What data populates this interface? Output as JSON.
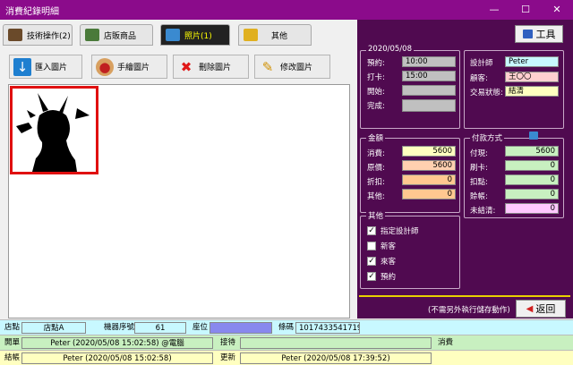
{
  "window": {
    "title": "消費紀錄明細",
    "minimize": "—",
    "maximize": "☐",
    "close": "✕"
  },
  "tabs": [
    {
      "label": "技術操作(2)",
      "active": false,
      "icon_color": "#6a4a2a"
    },
    {
      "label": "店販商品",
      "active": false,
      "icon_color": "#4a7a3a"
    },
    {
      "label": "照片(1)",
      "active": true,
      "icon_color": "#3a8ad0"
    },
    {
      "label": "其他",
      "active": false,
      "icon_color": "#e0b020"
    }
  ],
  "photo_toolbar": {
    "import_label": "匯入圖片",
    "draw_label": "手繪圖片",
    "delete_label": "刪除圖片",
    "edit_label": "修改圖片"
  },
  "right": {
    "tool_label": "工具",
    "date": "2020/05/08",
    "times": {
      "reserve_label": "預約:",
      "reserve_value": "10:00",
      "clockin_label": "打卡:",
      "clockin_value": "15:00",
      "start_label": "開始:",
      "start_value": "",
      "finish_label": "完成:",
      "finish_value": ""
    },
    "people": {
      "designer_label": "設計師",
      "designer_value": "Peter",
      "customer_label": "顧客:",
      "customer_value": "王〇〇",
      "status_label": "交易狀態:",
      "status_value": "結清"
    },
    "amount": {
      "title": "金額",
      "consume_label": "消費:",
      "consume_value": "5600",
      "original_label": "原價:",
      "original_value": "5600",
      "discount_label": "折扣:",
      "discount_value": "0",
      "other_label": "其他:",
      "other_value": "0"
    },
    "payment": {
      "title": "付款方式",
      "cash_label": "付現:",
      "cash_value": "5600",
      "card_label": "刷卡:",
      "card_value": "0",
      "points_label": "扣點:",
      "points_value": "0",
      "credit_label": "賒帳:",
      "credit_value": "0",
      "unpaid_label": "未結清:",
      "unpaid_value": "0"
    },
    "other": {
      "title": "其他",
      "checks": [
        {
          "label": "指定設計師",
          "checked": true
        },
        {
          "label": "新客",
          "checked": false
        },
        {
          "label": "來客",
          "checked": true
        },
        {
          "label": "預約",
          "checked": true
        }
      ]
    },
    "note": "(不需另外執行儲存動作)",
    "back_label": "返回"
  },
  "status": {
    "store_label": "店點",
    "store_value": "店點A",
    "machine_label": "機器序號",
    "machine_value": "61",
    "seat_label": "座位",
    "code_label": "條碼",
    "code_value": "1017433541719",
    "open_label": "開單",
    "open_value": "Peter (2020/05/08 15:02:58) @電腦",
    "receive_label": "接待",
    "receive_value": "",
    "consume_label": "消費",
    "close_label": "結帳",
    "close_value": "Peter (2020/05/08 15:02:58)",
    "update_label": "更新",
    "update_value": "Peter (2020/05/08 17:39:52)"
  },
  "colors": {
    "titlebar": "#8b0b8b",
    "panel": "#500a50",
    "field_gray": "#c0c0c0",
    "field_yellow": "#ffffc0",
    "field_orange": "#ffc890",
    "field_green": "#c8f0c0",
    "field_pink": "#ffc8ff",
    "field_cyan": "#c8f8ff",
    "field_peach": "#ffd0b0"
  }
}
